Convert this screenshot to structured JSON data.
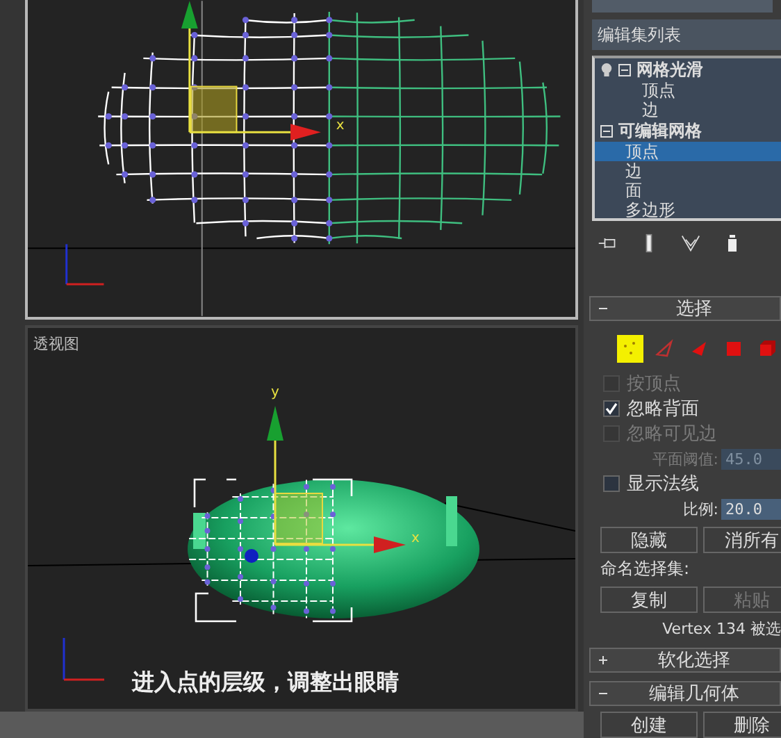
{
  "top_viewport": {
    "gizmo_labels": [
      "x"
    ]
  },
  "perspective_viewport": {
    "label": "透视图",
    "gizmo_labels": [
      "y",
      "x"
    ],
    "caption": "进入点的层级，调整出眼睛"
  },
  "command_panel": {
    "modifier_list": "编辑集列表",
    "stack": [
      {
        "label": "网格光滑",
        "expanded": true,
        "children": [
          {
            "label": "顶点",
            "selected": false
          },
          {
            "label": "边",
            "selected": false
          }
        ]
      },
      {
        "label": "可编辑网格",
        "expanded": true,
        "children": [
          {
            "label": "顶点",
            "selected": true
          },
          {
            "label": "边",
            "selected": false
          },
          {
            "label": "面",
            "selected": false
          },
          {
            "label": "多边形",
            "selected": false
          }
        ]
      }
    ],
    "selection": {
      "title": "选择",
      "expanded": true,
      "modes": [
        {
          "kind": "vertex",
          "selected": true
        },
        {
          "kind": "edge",
          "selected": false
        },
        {
          "kind": "face",
          "selected": false
        },
        {
          "kind": "polygon",
          "selected": false
        },
        {
          "kind": "element",
          "selected": false
        }
      ],
      "options": [
        {
          "kind": "checkbox",
          "label": "按顶点",
          "checked": false,
          "disabled": true
        },
        {
          "kind": "checkbox",
          "label": "忽略背面",
          "checked": true,
          "disabled": false
        },
        {
          "kind": "checkbox",
          "label": "忽略可见边",
          "checked": false,
          "disabled": true
        },
        {
          "kind": "spinner",
          "label": "平面阈值:",
          "value": "45.0",
          "disabled": true
        },
        {
          "kind": "checkbox",
          "label": "显示法线",
          "checked": false,
          "disabled": false
        },
        {
          "kind": "spinner",
          "label": "比例:",
          "value": "20.0",
          "disabled": false
        }
      ],
      "buttons": [
        {
          "label": "隐藏",
          "disabled": false
        },
        {
          "label": "消所有",
          "disabled": false
        }
      ],
      "named_sets_label": "命名选择集:",
      "set_buttons": [
        {
          "label": "复制",
          "disabled": false
        },
        {
          "label": "粘贴",
          "disabled": true
        }
      ],
      "status": "Vertex 134 被选"
    },
    "rollouts": [
      {
        "title": "软化选择",
        "expanded": false
      },
      {
        "title": "编辑几何体",
        "expanded": true
      }
    ],
    "geometry_buttons": [
      "创建",
      "删除"
    ]
  }
}
